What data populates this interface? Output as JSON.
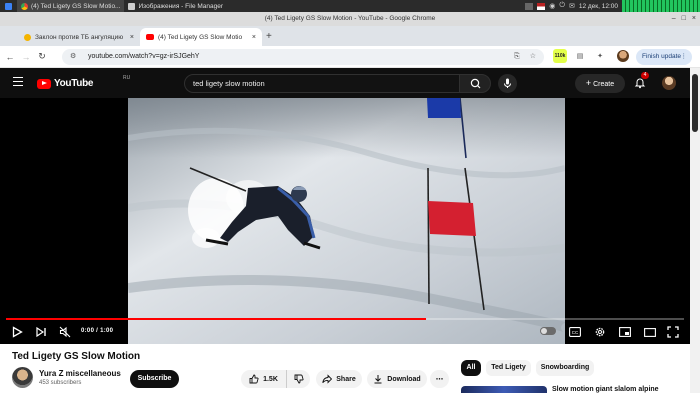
{
  "taskbar": {
    "tasks": [
      {
        "label": "(4) Ted Ligety GS Slow Motio...",
        "active": true
      },
      {
        "label": "Изображения - File Manager",
        "active": false
      }
    ],
    "clock": "12 дек, 12:00"
  },
  "window": {
    "title": "(4) Ted Ligety GS Slow Motion - YouTube - Google Chrome"
  },
  "tabs": [
    {
      "label": "Заклон против ТБ ангуляцию",
      "active": false
    },
    {
      "label": "(4) Ted Ligety GS Slow Motio",
      "active": true
    }
  ],
  "address": {
    "url": "youtube.com/watch?v=gz-irSJGehY",
    "finish_update": "Finish update",
    "ext_badge": "110k"
  },
  "yt": {
    "logo": "YouTube",
    "country": "RU",
    "search_query": "ted ligety slow motion",
    "create_label": "Create",
    "notif_count": "4"
  },
  "player": {
    "time": "0:00 / 1:00",
    "progress": 0.62,
    "gate_banner": "",
    "colors": {
      "progress": "#ff0000",
      "gate": "#d42030",
      "flag": "#1b3aa8"
    }
  },
  "video_info": {
    "title": "Ted Ligety GS Slow Motion",
    "channel": "Yura Z miscellaneous",
    "subscribers": "453 subscribers",
    "subscribe_label": "Subscribe",
    "likes": "1.5K",
    "share_label": "Share",
    "download_label": "Download"
  },
  "chips": [
    {
      "label": "All",
      "active": true
    },
    {
      "label": "Ted Ligety",
      "active": false
    },
    {
      "label": "Snowboarding",
      "active": false
    }
  ],
  "related": {
    "title": "Slow motion giant slalom alpine"
  }
}
